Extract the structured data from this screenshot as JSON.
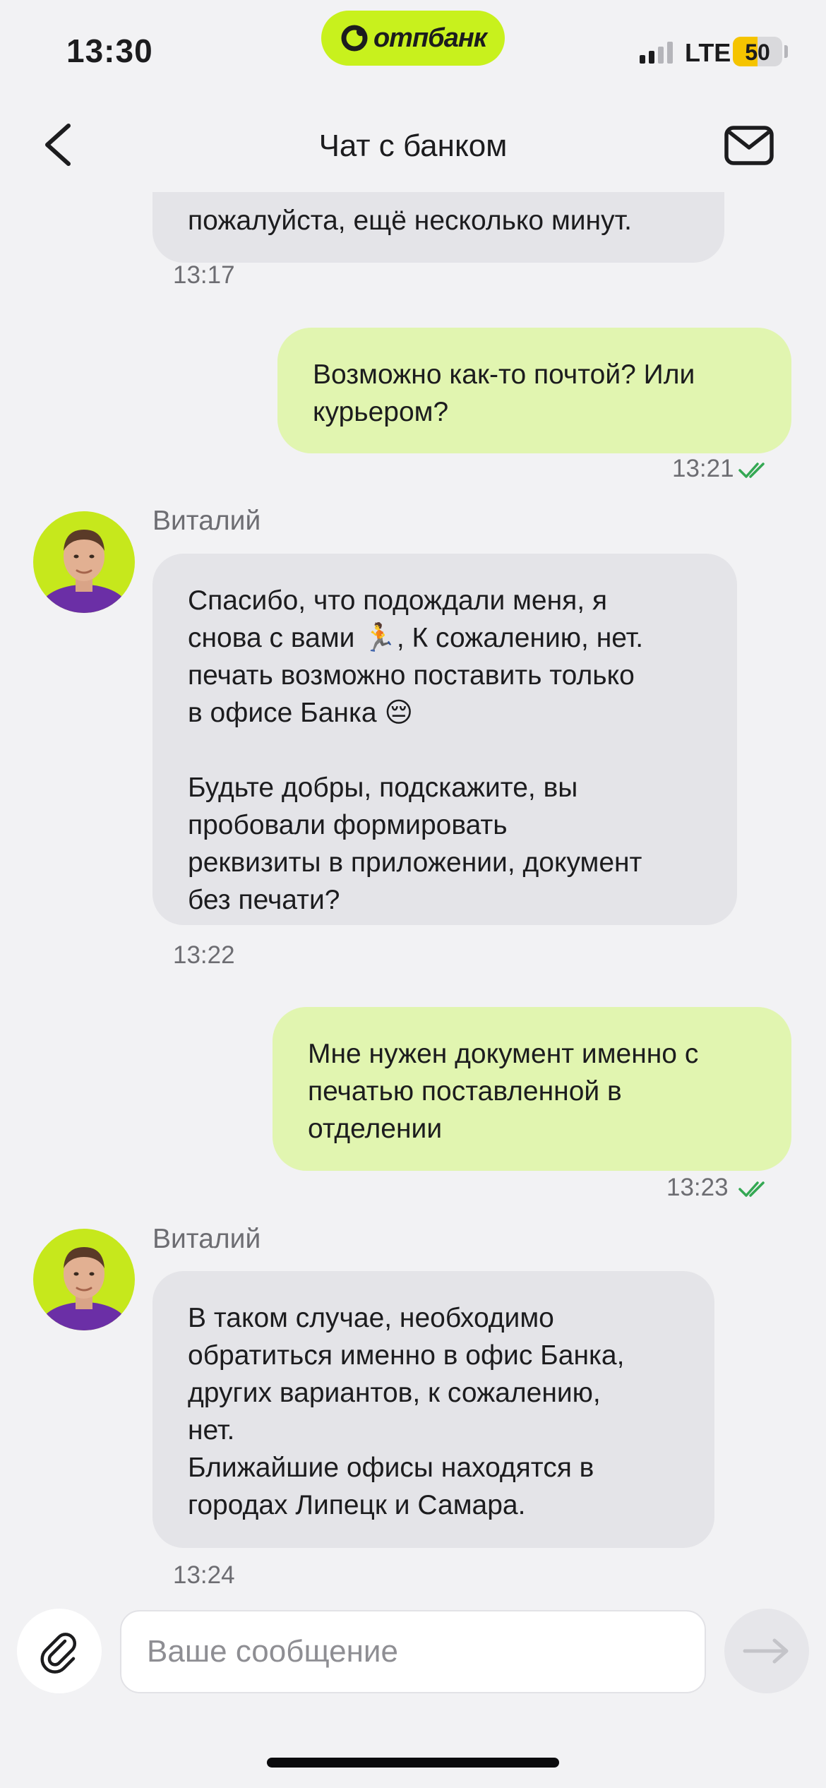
{
  "status_bar": {
    "time": "13:30",
    "brand": "отпбанк",
    "network": "LTE",
    "battery": "50",
    "battery_level_percent": 50,
    "signal_bars_active": 2,
    "signal_bars_total": 4
  },
  "nav": {
    "back_icon": "chevron-left-icon",
    "title": "Чат с банком",
    "mail_icon": "envelope-icon"
  },
  "messages": [
    {
      "direction": "in",
      "text": "пожалуйста, ещё несколько минут.",
      "time": "13:17"
    },
    {
      "direction": "out",
      "text": "Возможно как-то почтой? Или\nкурьером?",
      "time": "13:21",
      "status_icon": "double-check-icon"
    },
    {
      "direction": "in",
      "sender": "Виталий",
      "text": "Спасибо, что подождали меня, я\nснова с вами 🏃, К сожалению, нет.\nпечать возможно поставить только\nв офисе Банка 😔\n\nБудьте добры, подскажите, вы\nпробовали формировать\nреквизиты в приложении, документ\nбез печати?",
      "time": "13:22"
    },
    {
      "direction": "out",
      "text": "Мне нужен документ именно с\nпечатью поставленной в\nотделении",
      "time": "13:23",
      "status_icon": "double-check-icon"
    },
    {
      "direction": "in",
      "sender": "Виталий",
      "text": "В таком случае, необходимо\nобратиться именно в офис Банка,\nдругих вариантов, к сожалению,\nнет.\nБлижайшие офисы находятся в\nгородах Липецк и Самара.",
      "time": "13:24"
    }
  ],
  "composer": {
    "placeholder": "Ваше сообщение",
    "attach_icon": "paperclip-icon",
    "send_icon": "arrow-right-icon"
  },
  "colors": {
    "background": "#f2f2f4",
    "brand_accent": "#c8f11d",
    "incoming_bubble": "#e4e4e8",
    "outgoing_bubble": "#e1f5b0",
    "read_check": "#34a853"
  }
}
